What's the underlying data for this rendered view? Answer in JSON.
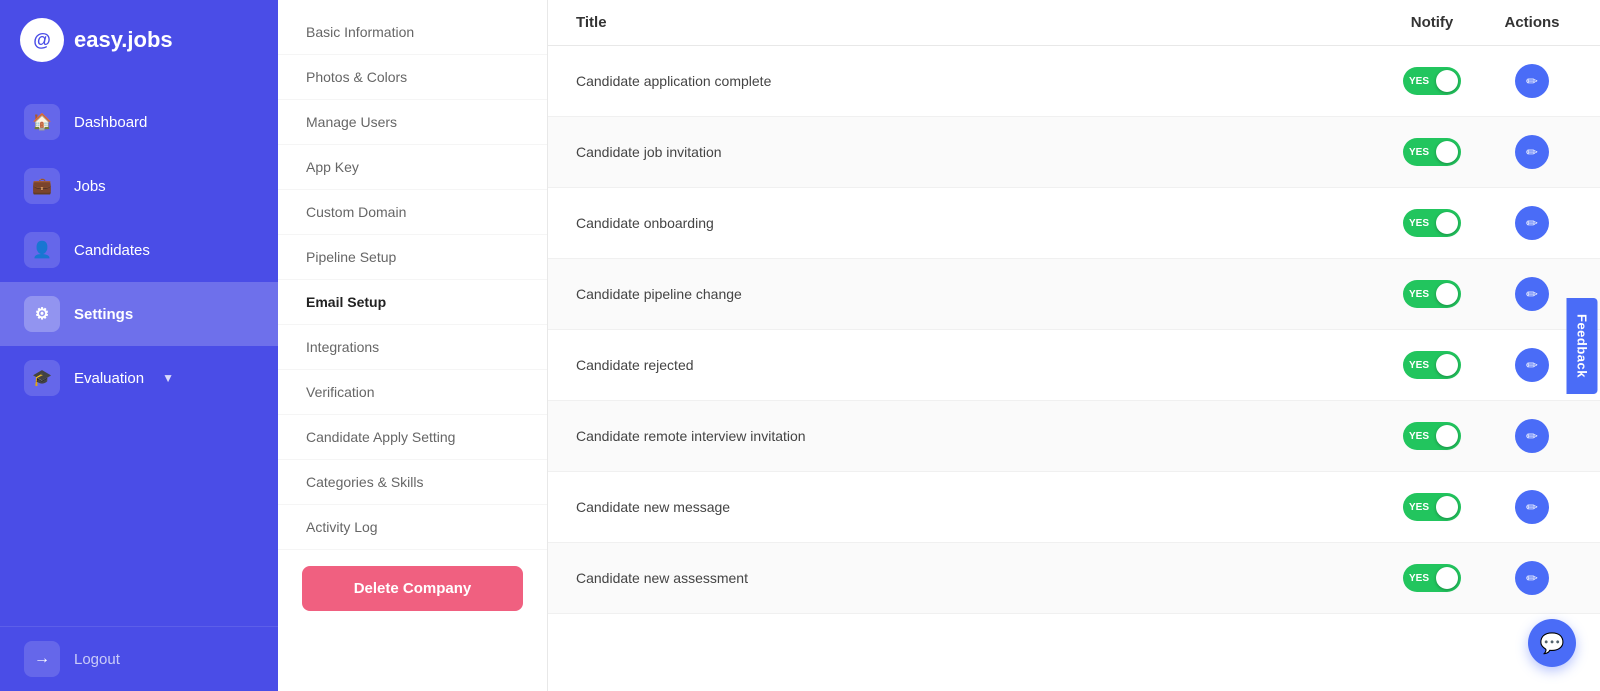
{
  "app": {
    "logo_text": "easy.jobs",
    "logo_icon": "@"
  },
  "sidebar": {
    "items": [
      {
        "id": "dashboard",
        "label": "Dashboard",
        "icon": "🏠"
      },
      {
        "id": "jobs",
        "label": "Jobs",
        "icon": "💼"
      },
      {
        "id": "candidates",
        "label": "Candidates",
        "icon": "👤"
      },
      {
        "id": "settings",
        "label": "Settings",
        "icon": "⚙",
        "active": true
      },
      {
        "id": "evaluation",
        "label": "Evaluation",
        "icon": "🎓",
        "has_arrow": true
      }
    ],
    "logout_label": "Logout",
    "logout_icon": "→"
  },
  "sub_menu": {
    "items": [
      {
        "id": "basic-information",
        "label": "Basic Information"
      },
      {
        "id": "photos-colors",
        "label": "Photos & Colors"
      },
      {
        "id": "manage-users",
        "label": "Manage Users"
      },
      {
        "id": "app-key",
        "label": "App Key"
      },
      {
        "id": "custom-domain",
        "label": "Custom Domain"
      },
      {
        "id": "pipeline-setup",
        "label": "Pipeline Setup"
      },
      {
        "id": "email-setup",
        "label": "Email Setup",
        "active": true
      },
      {
        "id": "integrations",
        "label": "Integrations"
      },
      {
        "id": "verification",
        "label": "Verification"
      },
      {
        "id": "candidate-apply-setting",
        "label": "Candidate Apply Setting"
      },
      {
        "id": "categories-skills",
        "label": "Categories & Skills"
      },
      {
        "id": "activity-log",
        "label": "Activity Log"
      }
    ],
    "delete_button_label": "Delete Company"
  },
  "table": {
    "columns": {
      "title": "Title",
      "notify": "Notify",
      "actions": "Actions"
    },
    "rows": [
      {
        "id": "row-1",
        "title": "Candidate application complete",
        "notify": true,
        "notify_label": "YES"
      },
      {
        "id": "row-2",
        "title": "Candidate job invitation",
        "notify": true,
        "notify_label": "YES"
      },
      {
        "id": "row-3",
        "title": "Candidate onboarding",
        "notify": true,
        "notify_label": "YES"
      },
      {
        "id": "row-4",
        "title": "Candidate pipeline change",
        "notify": true,
        "notify_label": "YES"
      },
      {
        "id": "row-5",
        "title": "Candidate rejected",
        "notify": true,
        "notify_label": "YES"
      },
      {
        "id": "row-6",
        "title": "Candidate remote interview invitation",
        "notify": true,
        "notify_label": "YES"
      },
      {
        "id": "row-7",
        "title": "Candidate new message",
        "notify": true,
        "notify_label": "YES"
      },
      {
        "id": "row-8",
        "title": "Candidate new assessment",
        "notify": true,
        "notify_label": "YES"
      }
    ]
  },
  "feedback": {
    "label": "Feedback"
  },
  "chat": {
    "icon": "💬"
  },
  "colors": {
    "sidebar_bg": "#4a4de7",
    "toggle_on": "#22c55e",
    "edit_btn": "#4a6cf7",
    "delete_btn": "#f06080",
    "feedback_tab": "#4a6cf7"
  }
}
